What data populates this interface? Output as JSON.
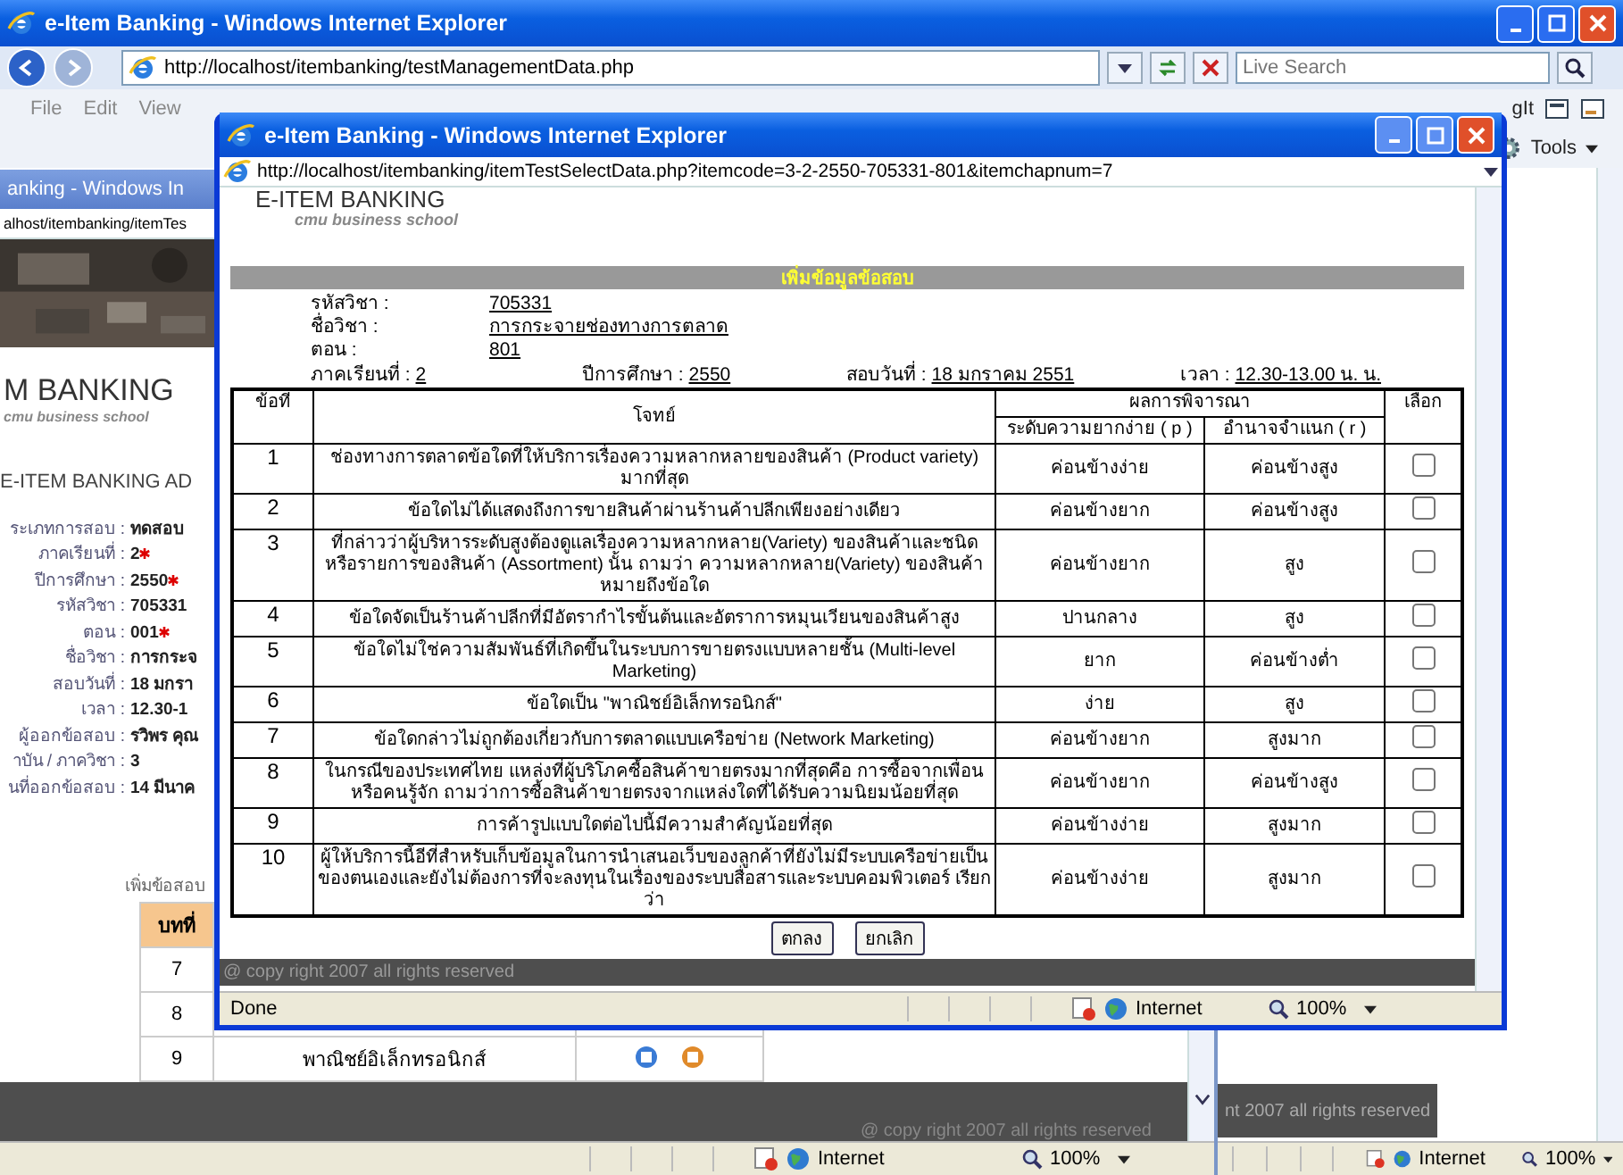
{
  "main_window": {
    "title": "e-Item Banking - Windows Internet Explorer",
    "address": "http://localhost/itembanking/testManagementData.php",
    "search": {
      "placeholder": "Live Search"
    },
    "menu": [
      "File",
      "Edit",
      "View"
    ],
    "toolbar_label": "gIt",
    "tools": "Tools",
    "footer": "nt 2007 all rights reserved",
    "status": {
      "zone": "Internet",
      "zoom": "100%"
    }
  },
  "middle_window": {
    "title": "anking - Windows In",
    "address": "alhost/itembanking/itemTes",
    "logo": {
      "name": "M BANKING",
      "tagline": "cmu business school"
    },
    "heading": "E-ITEM BANKING AD",
    "form": [
      {
        "label": "ระเภทการสอบ :",
        "value": "ทดสอบ",
        "required": false
      },
      {
        "label": "ภาคเรียนที่ :",
        "value": "2",
        "required": true
      },
      {
        "label": "ปีการศึกษา :",
        "value": "2550",
        "required": true
      },
      {
        "label": "รหัสวิชา :",
        "value": "705331",
        "required": false
      },
      {
        "label": "ตอน :",
        "value": "001",
        "required": true
      },
      {
        "label": "ชื่อวิชา :",
        "value": "การกระจ",
        "required": false
      },
      {
        "label": "สอบวันที่ :",
        "value": "18 มกรา",
        "required": false
      },
      {
        "label": "เวลา :",
        "value": "12.30-1",
        "required": false
      },
      {
        "label": "ผู้ออกข้อสอบ :",
        "value": "รวิพร คุณ",
        "required": false
      },
      {
        "label": "าบัน / ภาควิชา :",
        "value": "3",
        "required": false
      },
      {
        "label": "นที่ออกข้อสอบ :",
        "value": "14 มีนาค",
        "required": false
      }
    ],
    "section": "เพิ่มข้อสอบ",
    "table": {
      "column": "บทที่",
      "rows": [
        {
          "chapter": "7"
        },
        {
          "chapter": "8"
        },
        {
          "chapter": "9",
          "topic": "พาณิชย์อิเล็กทรอนิกส์"
        }
      ]
    },
    "footer": "@ copy right 2007 all rights reserved",
    "status": {
      "zone": "Internet",
      "zoom": "100%"
    }
  },
  "popup": {
    "title": "e-Item Banking - Windows Internet Explorer",
    "address": "http://localhost/itembanking/itemTestSelectData.php?itemcode=3-2-2550-705331-801&itemchapnum=7",
    "logo": {
      "name": "E-ITEM BANKING",
      "tagline": "cmu business school"
    },
    "banner": "เพิ่มข้อมูลข้อสอบ",
    "info": [
      {
        "label": "รหัสวิชา :",
        "value": "705331"
      },
      {
        "label": "ชื่อวิชา :",
        "value": "การกระจายช่องทางการตลาด"
      },
      {
        "label": "ตอน :",
        "value": "801"
      }
    ],
    "info_line": [
      {
        "label": "ภาคเรียนที่ :",
        "value": "2"
      },
      {
        "label": "ปีการศึกษา :",
        "value": "2550"
      },
      {
        "label": "สอบวันที่ :",
        "value": "18 มกราคม  2551"
      },
      {
        "label": "เวลา :",
        "value": "12.30-13.00 น. น."
      }
    ],
    "table": {
      "columns": {
        "number": "ข้อที่",
        "question": "โจทย์",
        "result": "ผลการพิจารณา",
        "difficulty": "ระดับความยากง่าย ( p )",
        "discrimination": "อำนาจจำแนก ( r )",
        "select": "เลือก"
      },
      "rows": [
        {
          "number": "1",
          "question": "ช่องทางการตลาดข้อใดที่ให้บริการเรื่องความหลากหลายของสินค้า (Product variety) มากที่สุด",
          "difficulty": "ค่อนข้างง่าย",
          "discrimination": "ค่อนข้างสูง",
          "checked": false
        },
        {
          "number": "2",
          "question": "ข้อใดไม่ได้แสดงถึงการขายสินค้าผ่านร้านค้าปลีกเพียงอย่างเดียว",
          "difficulty": "ค่อนข้างยาก",
          "discrimination": "ค่อนข้างสูง",
          "checked": false
        },
        {
          "number": "3",
          "question": "ที่กล่าวว่าผู้บริหารระดับสูงต้องดูแลเรื่องความหลากหลาย(Variety) ของสินค้าและชนิดหรือรายการของสินค้า (Assortment) นั้น ถามว่า ความหลากหลาย(Variety) ของสินค้า หมายถึงข้อใด",
          "difficulty": "ค่อนข้างยาก",
          "discrimination": "สูง",
          "checked": false
        },
        {
          "number": "4",
          "question": "ข้อใดจัดเป็นร้านค้าปลีกที่มีอัตรากำไรขั้นต้นและอัตราการหมุนเวียนของสินค้าสูง",
          "difficulty": "ปานกลาง",
          "discrimination": "สูง",
          "checked": false
        },
        {
          "number": "5",
          "question": "ข้อใดไม่ใช่ความสัมพันธ์ที่เกิดขึ้นในระบบการขายตรงแบบหลายชั้น (Multi-level Marketing)",
          "difficulty": "ยาก",
          "discrimination": "ค่อนข้างต่ำ",
          "checked": false
        },
        {
          "number": "6",
          "question": "ข้อใดเป็น \"พาณิชย์อิเล็กทรอนิกส์\"",
          "difficulty": "ง่าย",
          "discrimination": "สูง",
          "checked": false
        },
        {
          "number": "7",
          "question": "ข้อใดกล่าวไม่ถูกต้องเกี่ยวกับการตลาดแบบเครือข่าย (Network Marketing)",
          "difficulty": "ค่อนข้างยาก",
          "discrimination": "สูงมาก",
          "checked": false
        },
        {
          "number": "8",
          "question": "ในกรณีของประเทศไทย แหล่งที่ผู้บริโภคซื้อสินค้าขายตรงมากที่สุดคือ การซื้อจากเพื่อนหรือคนรู้จัก ถามว่าการซื้อสินค้าขายตรงจากแหล่งใดที่ได้รับความนิยมน้อยที่สุด",
          "difficulty": "ค่อนข้างยาก",
          "discrimination": "ค่อนข้างสูง",
          "checked": false
        },
        {
          "number": "9",
          "question": "การค้ารูปแบบใดต่อไปนี้มีความสำคัญน้อยที่สุด",
          "difficulty": "ค่อนข้างง่าย",
          "discrimination": "สูงมาก",
          "checked": false
        },
        {
          "number": "10",
          "question": "ผู้ให้บริการนี้อีที่สำหรับเก็บข้อมูลในการนำเสนอเว็บของลูกค้าที่ยังไม่มีระบบเครือข่ายเป็นของตนเองและยังไม่ต้องการที่จะลงทุนในเรื่องของระบบสื่อสารและระบบคอมพิวเตอร์ เรียกว่า",
          "difficulty": "ค่อนข้างง่าย",
          "discrimination": "สูงมาก",
          "checked": false
        }
      ]
    },
    "buttons": [
      "ตกลง",
      "ยกเลิก"
    ],
    "footer": "@ copy right 2007 all rights reserved",
    "status": {
      "text": "Done",
      "zone": "Internet",
      "zoom": "100%"
    }
  }
}
